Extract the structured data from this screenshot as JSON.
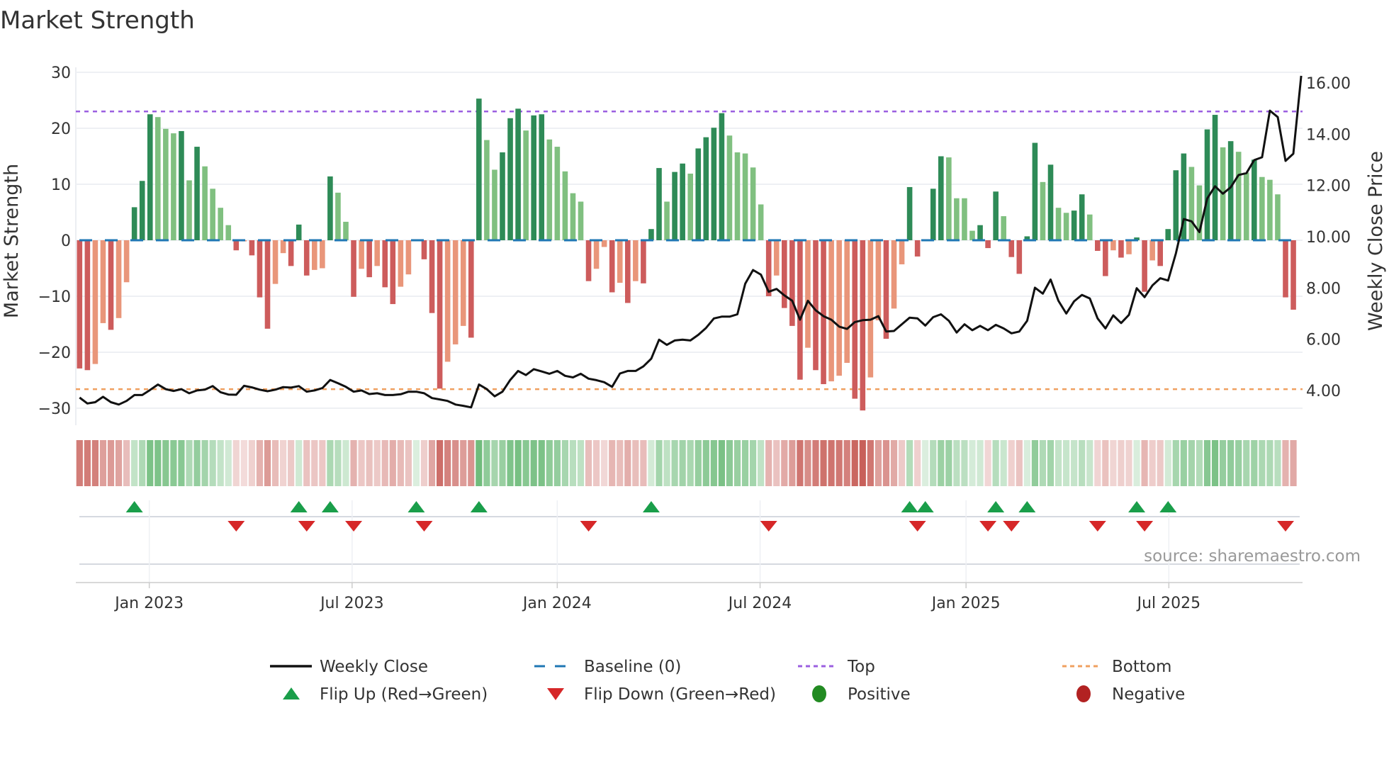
{
  "title": "Market Strength",
  "source": "source: sharemaestro.com",
  "colors": {
    "pos_dark": "#2e8b57",
    "pos_light": "#80c080",
    "neg_dark": "#cd5c5c",
    "neg_light": "#e9967a",
    "baseline": "#1f77b4",
    "top": "#9b5fe0",
    "bottom": "#f0a060",
    "price": "#111111",
    "flip_up": "#1a9e4a",
    "flip_down": "#d62728",
    "positive": "#228b22",
    "negative": "#b22222",
    "strip_pos": "#5cb36a",
    "strip_neg": "#c8605a"
  },
  "chart_data": {
    "type": "bar",
    "title": "Market Strength",
    "ylabel": "Market Strength",
    "y2label": "Weekly Close Price",
    "ylim": [
      -32,
      32
    ],
    "y2lim": [
      3.2,
      16.8
    ],
    "yticks": [
      "30",
      "20",
      "10",
      "0",
      "−10",
      "−20",
      "−30"
    ],
    "ytick_values": [
      30,
      20,
      10,
      0,
      -10,
      -20,
      -30
    ],
    "y2ticks": [
      "16.00",
      "14.00",
      "12.00",
      "10.00",
      "8.00",
      "6.00",
      "4.00"
    ],
    "y2tick_values": [
      16,
      14,
      12,
      10,
      8,
      6,
      4
    ],
    "xticks": [
      "Jan 2023",
      "Jul 2023",
      "Jan 2024",
      "Jul 2024",
      "Jan 2025",
      "Jul 2025"
    ],
    "xtick_week_index": [
      8.9,
      34.8,
      61,
      86.9,
      113.2,
      139.1
    ],
    "top_level": 23,
    "bottom_level": -26.6,
    "grid": true,
    "legend_position": "bottom",
    "strength": [
      -22.9,
      -23.2,
      -22.1,
      -14.8,
      -16.0,
      -13.9,
      -7.5,
      5.9,
      10.6,
      22.5,
      22.0,
      19.9,
      19.1,
      19.5,
      10.7,
      16.7,
      13.2,
      9.2,
      5.8,
      2.7,
      -1.8,
      -0.2,
      -2.7,
      -10.2,
      -15.8,
      -7.8,
      -2.3,
      -4.6,
      2.8,
      -6.3,
      -5.3,
      -5.0,
      11.4,
      8.5,
      3.3,
      -10.1,
      -5.1,
      -6.6,
      -4.6,
      -8.4,
      -11.4,
      -8.3,
      -6.1,
      0.1,
      -3.4,
      -13.0,
      -26.5,
      -21.7,
      -18.6,
      -15.3,
      -17.4,
      25.3,
      17.9,
      12.6,
      15.7,
      21.8,
      23.5,
      19.6,
      22.3,
      22.5,
      18.0,
      16.7,
      12.3,
      8.4,
      6.9,
      -7.3,
      -5.1,
      -1.2,
      -9.3,
      -7.6,
      -11.2,
      -7.3,
      -7.7,
      2.0,
      12.9,
      6.9,
      12.2,
      13.7,
      11.9,
      16.4,
      18.4,
      20.1,
      22.7,
      18.7,
      15.7,
      15.5,
      13.0,
      6.4,
      -10.0,
      -6.3,
      -12.1,
      -15.3,
      -24.9,
      -19.2,
      -23.2,
      -25.7,
      -25.2,
      -24.2,
      -21.9,
      -28.3,
      -30.4,
      -24.5,
      -14.3,
      -17.6,
      -12.2,
      -4.3,
      9.5,
      -2.9,
      0.1,
      9.2,
      15.0,
      14.8,
      7.5,
      7.5,
      1.7,
      2.7,
      -1.4,
      8.7,
      4.3,
      -3.0,
      -6.0,
      0.7,
      17.4,
      10.4,
      13.5,
      5.8,
      4.9,
      5.3,
      8.2,
      4.6,
      -1.9,
      -6.4,
      -1.8,
      -3.1,
      -2.5,
      0.5,
      -9.2,
      -3.6,
      -4.6,
      2.0,
      12.5,
      15.5,
      13.1,
      9.8,
      19.8,
      22.4,
      16.6,
      17.7,
      15.8,
      12.1,
      14.4,
      11.3,
      10.8,
      8.2,
      -10.2,
      -12.4,
      0
    ],
    "weekly_close": [
      3.72,
      3.49,
      3.54,
      3.75,
      3.54,
      3.45,
      3.59,
      3.82,
      3.82,
      4.02,
      4.23,
      4.05,
      3.98,
      4.05,
      3.89,
      4.0,
      4.03,
      4.17,
      3.93,
      3.84,
      3.83,
      4.18,
      4.12,
      4.03,
      3.97,
      4.03,
      4.13,
      4.11,
      4.17,
      3.95,
      4.0,
      4.09,
      4.41,
      4.28,
      4.14,
      3.95,
      4.0,
      3.86,
      3.89,
      3.82,
      3.82,
      3.85,
      3.95,
      3.95,
      3.89,
      3.7,
      3.65,
      3.59,
      3.45,
      3.4,
      3.34,
      4.23,
      4.05,
      3.77,
      3.95,
      4.41,
      4.76,
      4.6,
      4.83,
      4.74,
      4.65,
      4.76,
      4.57,
      4.51,
      4.65,
      4.46,
      4.4,
      4.32,
      4.14,
      4.66,
      4.76,
      4.76,
      4.94,
      5.24,
      5.98,
      5.78,
      5.95,
      5.98,
      5.95,
      6.17,
      6.44,
      6.81,
      6.88,
      6.88,
      6.97,
      8.17,
      8.7,
      8.52,
      7.85,
      7.96,
      7.71,
      7.5,
      6.76,
      7.5,
      7.13,
      6.9,
      6.76,
      6.49,
      6.4,
      6.67,
      6.74,
      6.76,
      6.9,
      6.3,
      6.32,
      6.58,
      6.84,
      6.81,
      6.53,
      6.86,
      6.97,
      6.72,
      6.26,
      6.58,
      6.35,
      6.52,
      6.35,
      6.56,
      6.42,
      6.23,
      6.3,
      6.72,
      8.01,
      7.78,
      8.33,
      7.5,
      7.0,
      7.48,
      7.73,
      7.59,
      6.81,
      6.42,
      6.93,
      6.63,
      6.95,
      7.99,
      7.64,
      8.1,
      8.38,
      8.29,
      9.35,
      10.69,
      10.6,
      10.18,
      11.49,
      11.97,
      11.68,
      11.93,
      12.41,
      12.48,
      12.99,
      13.1,
      14.92,
      14.67,
      12.96,
      13.24,
      16.28
    ],
    "legend": [
      {
        "label": "Weekly Close",
        "kind": "line"
      },
      {
        "label": "Baseline (0)",
        "kind": "dash"
      },
      {
        "label": "Top",
        "kind": "dot-top"
      },
      {
        "label": "Bottom",
        "kind": "dot-bottom"
      },
      {
        "label": "Flip Up (Red→Green)",
        "kind": "tri-up"
      },
      {
        "label": "Flip Down (Green→Red)",
        "kind": "tri-down"
      },
      {
        "label": "Positive",
        "kind": "dot-pos"
      },
      {
        "label": "Negative",
        "kind": "dot-neg"
      }
    ]
  }
}
